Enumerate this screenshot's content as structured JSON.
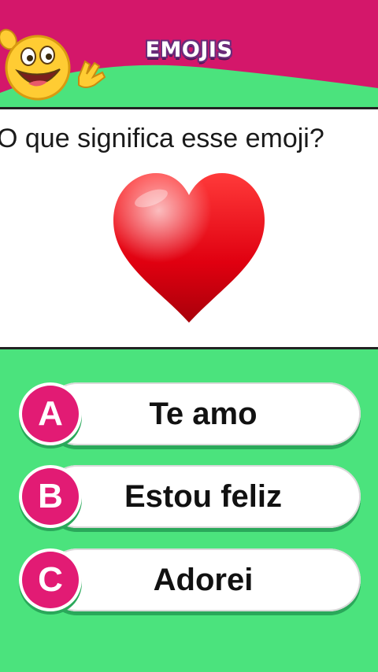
{
  "header": {
    "title": "EMOJIS",
    "mascot_icon": "grinning-waving-emoji-icon"
  },
  "question": {
    "text": "O que significa esse emoji?",
    "emoji_icon": "red-heart-icon"
  },
  "answers": [
    {
      "letter": "A",
      "label": "Te amo"
    },
    {
      "letter": "B",
      "label": "Estou feliz"
    },
    {
      "letter": "C",
      "label": "Adorei"
    }
  ],
  "colors": {
    "header_magenta": "#d4176a",
    "background_green": "#4be37d",
    "badge_pink": "#e21b74"
  }
}
